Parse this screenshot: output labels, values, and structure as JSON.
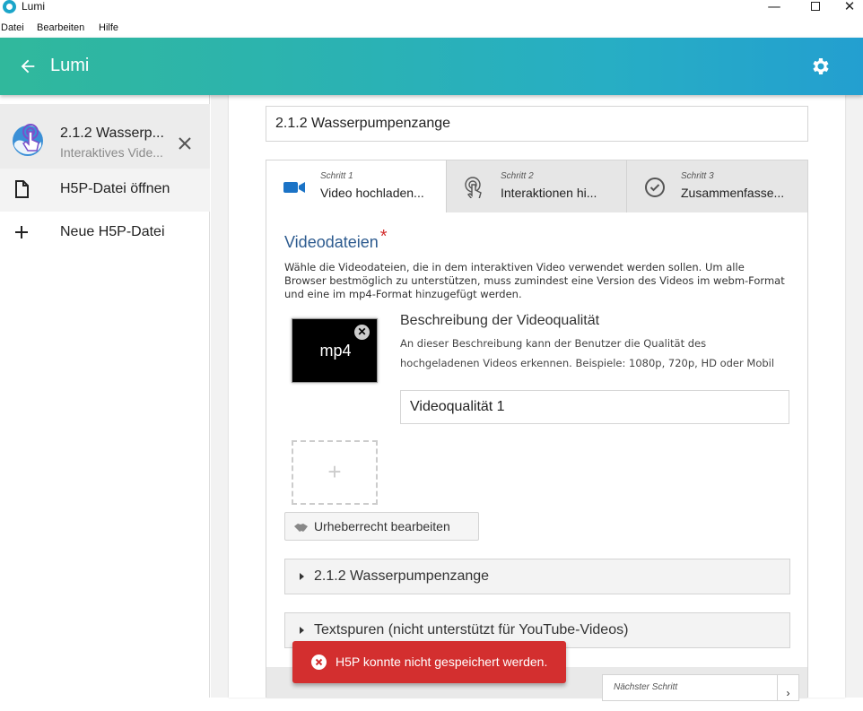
{
  "window": {
    "title": "Lumi"
  },
  "menu": [
    "Datei",
    "Bearbeiten",
    "Hilfe"
  ],
  "header": {
    "title": "Lumi",
    "accent": "#27aec4"
  },
  "sidebar": {
    "file": {
      "name": "2.1.2 Wasserp...",
      "type": "Interaktives Vide..."
    },
    "actions": [
      {
        "label": "H5P-Datei öffnen",
        "icon": "file-icon"
      },
      {
        "label": "Neue H5P-Datei",
        "icon": "plus-icon"
      }
    ]
  },
  "editor": {
    "title_value": "2.1.2 Wasserpumpenzange",
    "tabs": [
      {
        "step": "Schritt 1",
        "label": "Video hochladen...",
        "icon": "video-camera-icon"
      },
      {
        "step": "Schritt 2",
        "label": "Interaktionen hi...",
        "icon": "touch-icon"
      },
      {
        "step": "Schritt 3",
        "label": "Zusammenfasse...",
        "icon": "check-circle-icon"
      }
    ],
    "section_title": "Videodateien",
    "required_mark": "*",
    "section_desc": "Wähle die Videodateien, die in dem interaktiven Video verwendet werden sollen. Um alle Browser bestmöglich zu unterstützen, muss zumindest eine Version des Videos im webm-Format und eine im mp4-Format hinzugefügt werden.",
    "video": {
      "format": "mp4",
      "quality_title": "Beschreibung der Videoqualität",
      "quality_desc": "An dieser Beschreibung kann der Benutzer die Qualität des hochgeladenen Videos erkennen. Beispiele: 1080p, 720p, HD oder Mobil",
      "quality_value": "Videoqualität 1"
    },
    "add_symbol": "+",
    "copyright_button": "Urheberrecht bearbeiten",
    "collapsibles": [
      "2.1.2 Wasserpumpenzange",
      "Textspuren (nicht unterstützt für YouTube-Videos)"
    ],
    "next_step": "Nächster Schritt"
  },
  "toast": {
    "message": "H5P konnte nicht gespeichert werden.",
    "color": "#d32f2f"
  }
}
